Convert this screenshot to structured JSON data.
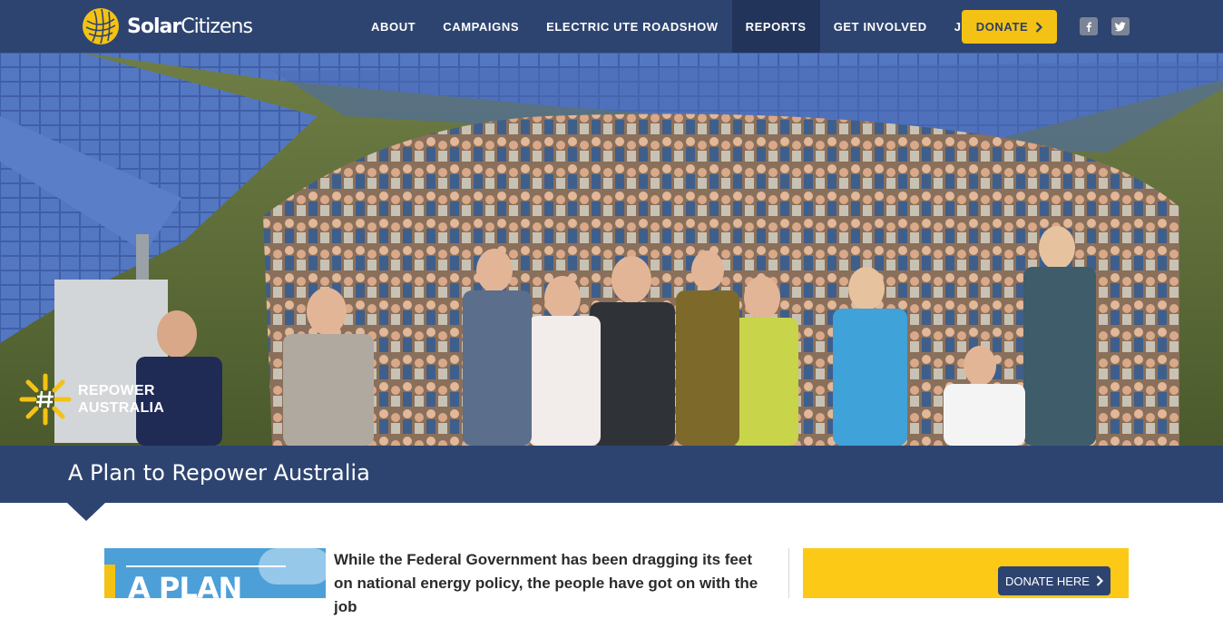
{
  "brand": {
    "name_bold": "Solar",
    "name_rest": "Citizens"
  },
  "nav": {
    "items": [
      {
        "label": "ABOUT",
        "active": false
      },
      {
        "label": "CAMPAIGNS",
        "active": false
      },
      {
        "label": "ELECTRIC UTE ROADSHOW",
        "active": false
      },
      {
        "label": "REPORTS",
        "active": true
      },
      {
        "label": "GET INVOLVED",
        "active": false
      },
      {
        "label": "JOIN",
        "active": false
      }
    ],
    "donate_label": "DONATE"
  },
  "social": [
    {
      "icon": "facebook-icon"
    },
    {
      "icon": "twitter-icon"
    }
  ],
  "hero": {
    "badge_line1": "REPOWER",
    "badge_line2": "AUSTRALIA"
  },
  "page": {
    "title": "A Plan to Repower Australia"
  },
  "content": {
    "report_cover_text": "A PLAN",
    "intro_text": "While the Federal Government has been dragging its feet on national energy policy, the people have got on with the job",
    "donate_here_label": "DONATE HERE"
  },
  "colors": {
    "navy": "#2e4470",
    "navy_dark": "#22345a",
    "accent_yellow": "#f3c214"
  }
}
